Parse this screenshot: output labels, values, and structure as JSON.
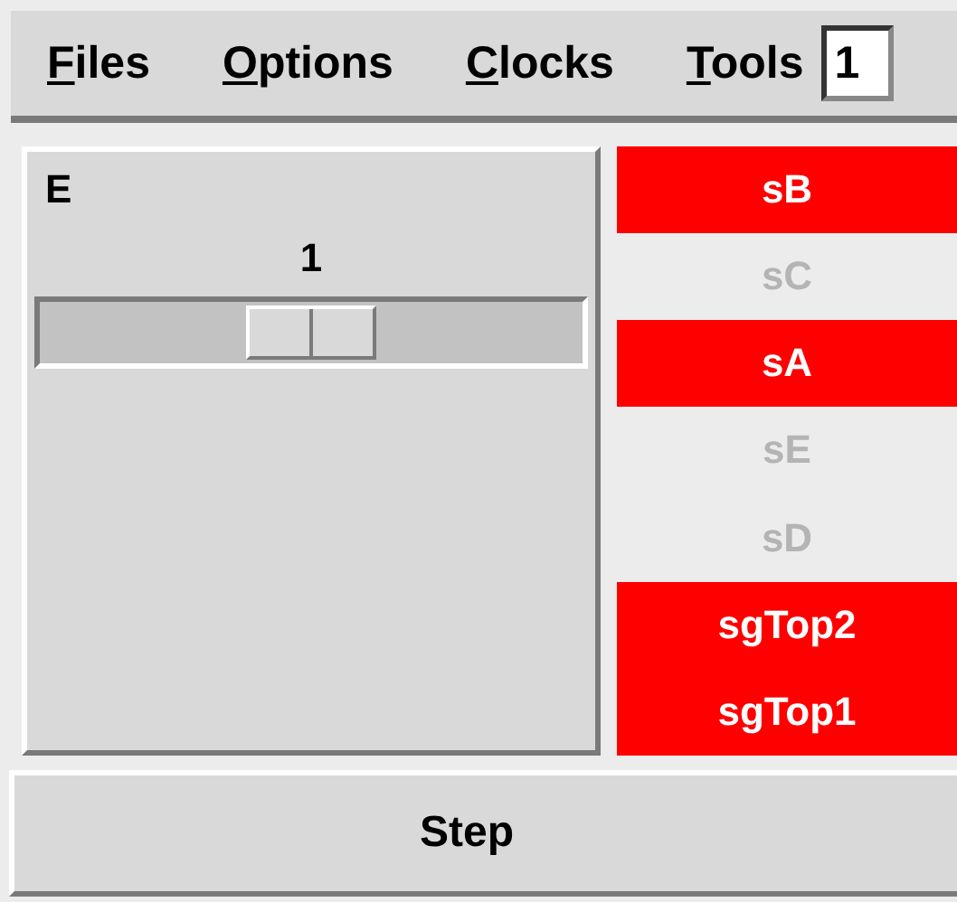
{
  "menu": [
    {
      "label": "Files"
    },
    {
      "label": "Options"
    },
    {
      "label": "Clocks"
    },
    {
      "label": "Tools"
    }
  ],
  "menu_field": {
    "value": "1"
  },
  "panel": {
    "title": "E",
    "value": "1",
    "slider": {
      "level": 0.5
    }
  },
  "signals": [
    {
      "label": "sB",
      "active": true
    },
    {
      "label": "sC",
      "active": false
    },
    {
      "label": "sA",
      "active": true
    },
    {
      "label": "sE",
      "active": false
    },
    {
      "label": "sD",
      "active": false
    },
    {
      "label": "sgTop2",
      "active": true
    },
    {
      "label": "sgTop1",
      "active": true
    }
  ],
  "step_button": {
    "label": "Step"
  }
}
